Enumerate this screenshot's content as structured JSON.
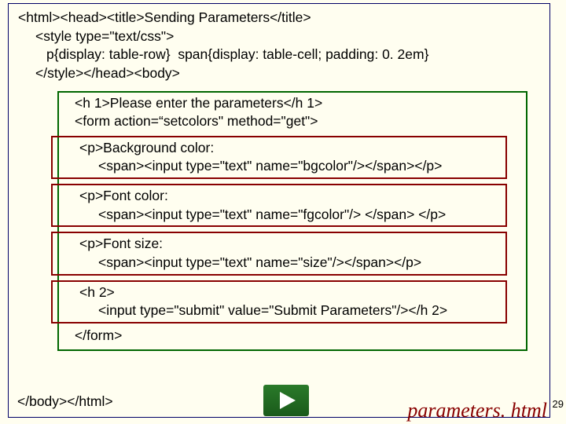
{
  "head": {
    "line1": "<html><head><title>Sending Parameters</title>",
    "line2": "<style type=\"text/css\">",
    "line3": "p{display: table-row}  span{display: table-cell; padding: 0. 2em}",
    "line4": "</style></head><body>"
  },
  "body": {
    "h1": "<h 1>Please enter the parameters</h 1>",
    "form_open": "<form action=“setcolors\" method=\"get\">",
    "bg_p": "<p>Background color:",
    "bg_span": "<span><input type=\"text\" name=\"bgcolor\"/></span></p>",
    "fg_p": "<p>Font color:",
    "fg_span": "<span><input type=\"text\" name=\"fgcolor\"/> </span> </p>",
    "sz_p": "<p>Font size:",
    "sz_span": "<span><input type=\"text\" name=\"size\"/></span></p>",
    "h2_open": "<h 2>",
    "submit": "<input type=\"submit\" value=\"Submit Parameters\"/></h 2>",
    "form_close": "</form>"
  },
  "footer": {
    "close": "</body></html>",
    "filename": "parameters. html",
    "page": "29"
  }
}
